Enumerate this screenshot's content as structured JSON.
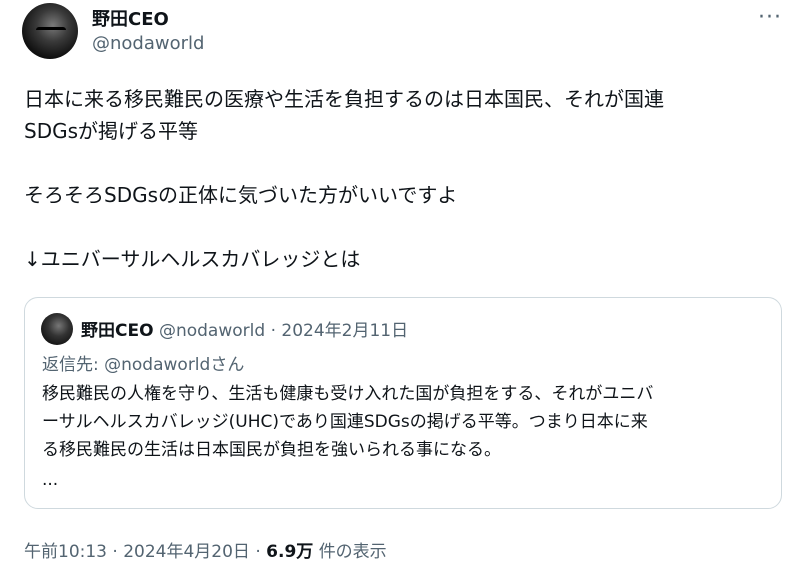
{
  "author": {
    "name": "野田CEO",
    "handle": "@nodaworld"
  },
  "more_icon": "more-options-icon",
  "more_label": "···",
  "tweet": {
    "line1": "日本に来る移民難民の医療や生活を負担するのは日本国民、それが国連",
    "line2": "SDGsが掲げる平等",
    "line3": "そろそろSDGsの正体に気づいた方がいいですよ",
    "line4": "↓ユニバーサルヘルスカバレッジとは"
  },
  "quote": {
    "name": "野田CEO",
    "handle": "@nodaworld",
    "separator": "·",
    "date": "2024年2月11日",
    "reply_to": "返信先: @nodaworldさん",
    "line1": "移民難民の人権を守り、生活も健康も受け入れた国が負担をする、それがユニバ",
    "line2": "ーサルヘルスカバレッジ(UHC)であり国連SDGsの掲げる平等。つまり日本に来",
    "line3": "る移民難民の生活は日本国民が負担を強いられる事になる。",
    "ellipsis": "..."
  },
  "footer": {
    "time": "午前10:13",
    "separator": "·",
    "date": "2024年4月20日",
    "separator2": "·",
    "views": "6.9万",
    "views_label": "件の表示"
  }
}
